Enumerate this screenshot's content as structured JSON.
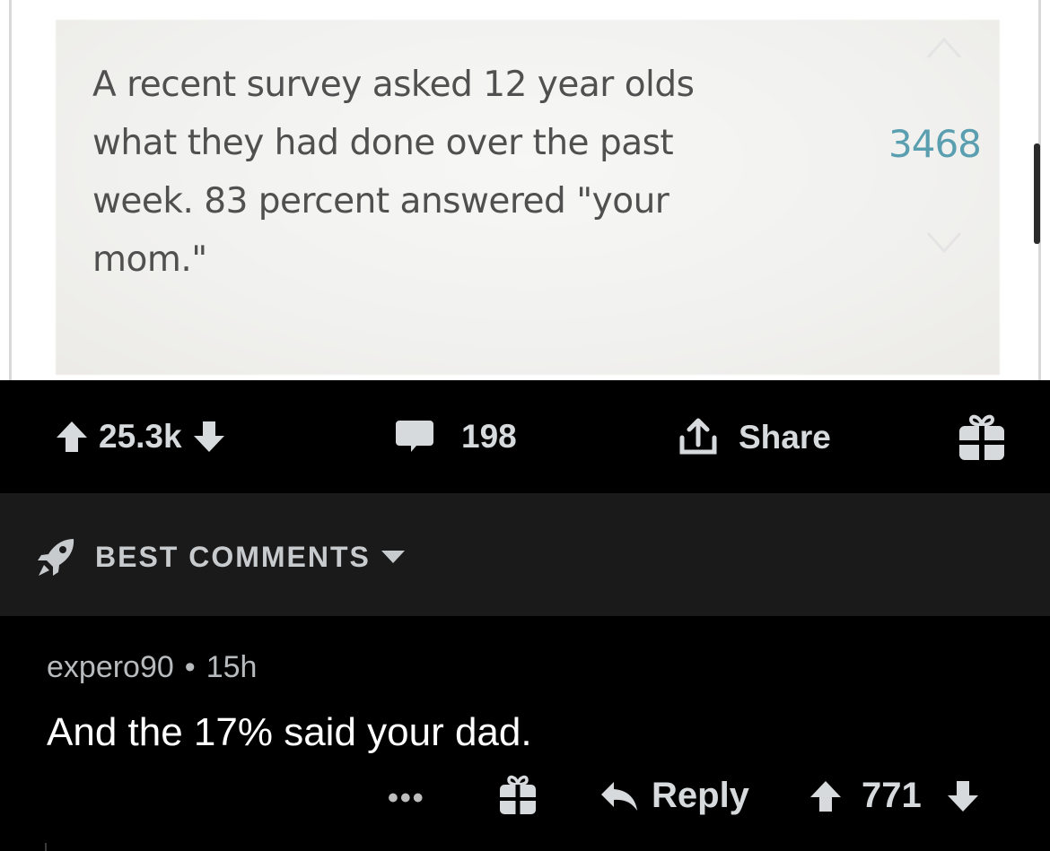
{
  "post_image": {
    "text_lines": [
      "A recent survey asked 12 year olds",
      "what they had done over the past",
      "week. 83 percent answered \"your",
      "mom.\""
    ],
    "vote_count": "3468"
  },
  "action_bar": {
    "score": "25.3k",
    "comments": "198",
    "share_label": "Share"
  },
  "sort": {
    "label": "BEST COMMENTS"
  },
  "comment": {
    "author": "expero90",
    "separator": "•",
    "age": "15h",
    "body": "And the 17% said your dad.",
    "more": "•••",
    "reply_label": "Reply",
    "score": "771"
  },
  "colors": {
    "background": "#000000",
    "sort_bar": "#1a1a1b",
    "text": "#d7dadc",
    "image_score": "#5a9fb0"
  }
}
